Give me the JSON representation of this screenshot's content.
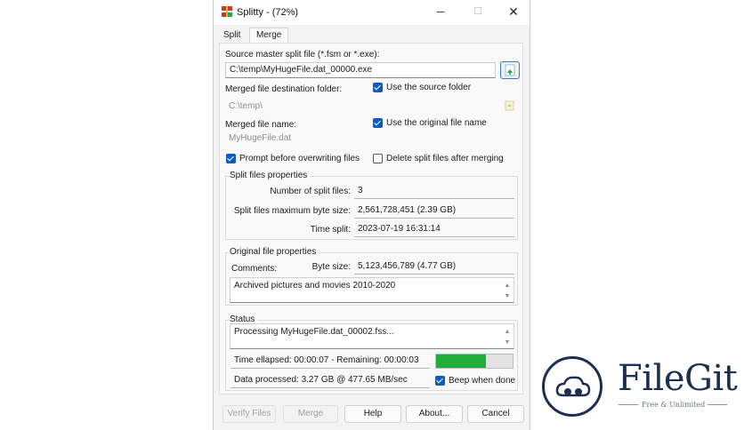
{
  "window": {
    "title": "Splitty - (72%)"
  },
  "tabs": [
    "Split",
    "Merge"
  ],
  "merge": {
    "source_label": "Source master split file (*.fsm or *.exe):",
    "source_value": "C:\\temp\\MyHugeFile.dat_00000.exe",
    "dest_label": "Merged file destination folder:",
    "dest_value": "C:\\temp\\",
    "use_source_folder": {
      "label": "Use the source folder",
      "checked": true
    },
    "name_label": "Merged file name:",
    "name_value": "MyHugeFile.dat",
    "use_original_name": {
      "label": "Use the original file name",
      "checked": true
    },
    "prompt_overwrite": {
      "label": "Prompt before overwriting files",
      "checked": true
    },
    "delete_after": {
      "label": "Delete split files after merging",
      "checked": false
    }
  },
  "split_props": {
    "title": "Split files properties",
    "num_label": "Number of split files:",
    "num_value": "3",
    "max_size_label": "Split files maximum byte size:",
    "max_size_value": "2,561,728,451 (2.39 GB)",
    "time_label": "Time split:",
    "time_value": "2023-07-19 16:31:14"
  },
  "original_props": {
    "title": "Original file properties",
    "comments_label": "Comments:",
    "byte_size_label": "Byte size:",
    "byte_size_value": "5,123,456,789 (4.77 GB)",
    "comments_value": "Archived pictures and movies 2010-2020"
  },
  "status": {
    "title": "Status",
    "message": "Processing MyHugeFile.dat_00002.fss...",
    "time": "Time ellapsed: 00:00:07 - Remaining: 00:00:03",
    "data": "Data processed: 3.27 GB @ 477.65 MB/sec",
    "progress": 0.65,
    "beep": {
      "label": "Beep when done",
      "checked": true
    }
  },
  "buttons": {
    "verify": "Verify Files",
    "merge": "Merge",
    "help": "Help",
    "about": "About...",
    "cancel": "Cancel"
  },
  "watermark": {
    "name": "FileGit",
    "tagline": "Free & Unlimited"
  },
  "colors": {
    "accent": "#0a5cc2",
    "progress": "#1fae3a",
    "brand": "#1c2f52"
  }
}
